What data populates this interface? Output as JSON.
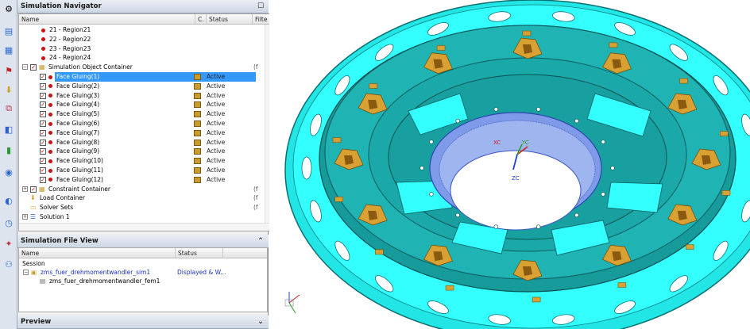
{
  "toolbar": {
    "icons": [
      "settings-icon",
      "sim-nav-icon",
      "part-nav-icon",
      "constraint-icon",
      "load-icon",
      "mesh-icon",
      "chart-icon",
      "results-icon",
      "solve-icon",
      "time-icon",
      "info-icon",
      "palette-icon"
    ]
  },
  "navigator": {
    "title": "Simulation Navigator",
    "columns": {
      "name": "Name",
      "c": "C.",
      "status": "Status",
      "filter": "Filte"
    },
    "rows": [
      {
        "label": "21 - Region21",
        "indent": 1,
        "type": "region"
      },
      {
        "label": "22 - Region22",
        "indent": 1,
        "type": "region"
      },
      {
        "label": "23 - Region23",
        "indent": 1,
        "type": "region"
      },
      {
        "label": "24 - Region24",
        "indent": 1,
        "type": "region"
      },
      {
        "label": "Simulation Object Container",
        "indent": 0,
        "type": "container",
        "filt": "(f"
      },
      {
        "label": "Face Gluing(1)",
        "indent": 1,
        "type": "glue",
        "status": "Active",
        "selected": true
      },
      {
        "label": "Face Gluing(2)",
        "indent": 1,
        "type": "glue",
        "status": "Active"
      },
      {
        "label": "Face Gluing(3)",
        "indent": 1,
        "type": "glue",
        "status": "Active"
      },
      {
        "label": "Face Gluing(4)",
        "indent": 1,
        "type": "glue",
        "status": "Active"
      },
      {
        "label": "Face Gluing(5)",
        "indent": 1,
        "type": "glue",
        "status": "Active"
      },
      {
        "label": "Face Gluing(6)",
        "indent": 1,
        "type": "glue",
        "status": "Active"
      },
      {
        "label": "Face Gluing(7)",
        "indent": 1,
        "type": "glue",
        "status": "Active"
      },
      {
        "label": "Face Gluing(8)",
        "indent": 1,
        "type": "glue",
        "status": "Active"
      },
      {
        "label": "Face Gluing(9)",
        "indent": 1,
        "type": "glue",
        "status": "Active"
      },
      {
        "label": "Face Gluing(10)",
        "indent": 1,
        "type": "glue",
        "status": "Active"
      },
      {
        "label": "Face Gluing(11)",
        "indent": 1,
        "type": "glue",
        "status": "Active"
      },
      {
        "label": "Face Gluing(12)",
        "indent": 1,
        "type": "glue",
        "status": "Active"
      },
      {
        "label": "Constraint Container",
        "indent": 0,
        "type": "container",
        "filt": "(f"
      },
      {
        "label": "Load Container",
        "indent": 0,
        "type": "load",
        "filt": "(f"
      },
      {
        "label": "Solver Sets",
        "indent": 0,
        "type": "folder",
        "filt": "(f"
      },
      {
        "label": "Solution 1",
        "indent": 0,
        "type": "solution"
      }
    ]
  },
  "file_view": {
    "title": "Simulation File View",
    "columns": {
      "name": "Name",
      "status": "Status"
    },
    "session": "Session",
    "sim": {
      "label": "zms_fuer_drehmomentwandler_sim1",
      "status": "Displayed & W..."
    },
    "fem": {
      "label": "zms_fuer_drehmomentwandler_fem1"
    }
  },
  "preview": {
    "title": "Preview"
  },
  "viewport": {
    "axis_x": "XC",
    "axis_y": "YC",
    "axis_z": "ZC",
    "colors": {
      "part": "#1ea3a3",
      "face": "#33ffff",
      "glue": "#d9a033",
      "mesh": "#4d6fd6"
    }
  }
}
